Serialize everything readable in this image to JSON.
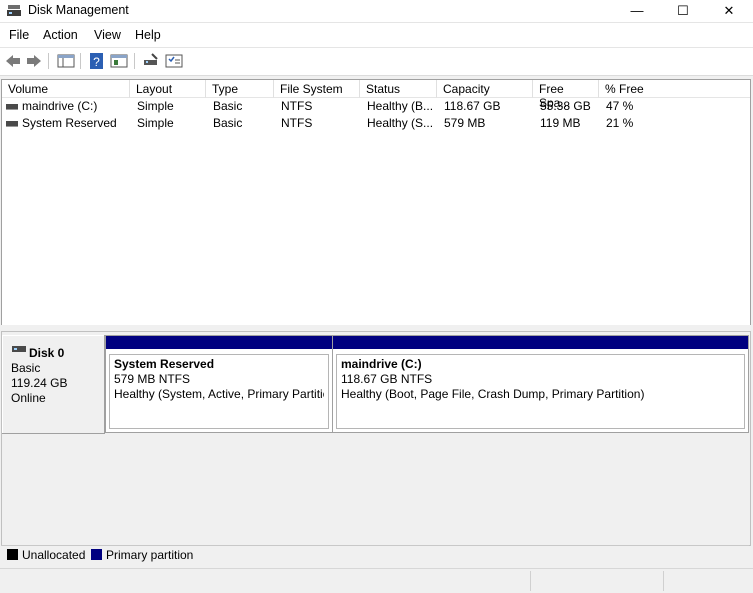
{
  "window": {
    "title": "Disk Management",
    "minimize": "—",
    "maximize": "☐",
    "close": "✕"
  },
  "menu": [
    "File",
    "Action",
    "View",
    "Help"
  ],
  "toolbar_icons": [
    "back-icon",
    "forward-icon",
    "console-tree-icon",
    "help-icon",
    "properties-icon",
    "rescan-icon",
    "settings-icon"
  ],
  "volume_table": {
    "columns": [
      "Volume",
      "Layout",
      "Type",
      "File System",
      "Status",
      "Capacity",
      "Free Spa...",
      "% Free"
    ],
    "rows": [
      {
        "volume": "maindrive (C:)",
        "layout": "Simple",
        "type": "Basic",
        "fs": "NTFS",
        "status": "Healthy (B...",
        "capacity": "118.67 GB",
        "free": "55.38 GB",
        "pct": "47 %"
      },
      {
        "volume": "System Reserved",
        "layout": "Simple",
        "type": "Basic",
        "fs": "NTFS",
        "status": "Healthy (S...",
        "capacity": "579 MB",
        "free": "119 MB",
        "pct": "21 %"
      }
    ]
  },
  "disk": {
    "name": "Disk 0",
    "type": "Basic",
    "size": "119.24 GB",
    "state": "Online",
    "partitions": [
      {
        "name": "System Reserved",
        "size_fs": "579 MB NTFS",
        "status": "Healthy (System, Active, Primary Partition)"
      },
      {
        "name": "maindrive  (C:)",
        "size_fs": "118.67 GB NTFS",
        "status": "Healthy (Boot, Page File, Crash Dump, Primary Partition)"
      }
    ]
  },
  "legend": [
    {
      "label": "Unallocated",
      "color": "#000000"
    },
    {
      "label": "Primary partition",
      "color": "#000080"
    }
  ]
}
